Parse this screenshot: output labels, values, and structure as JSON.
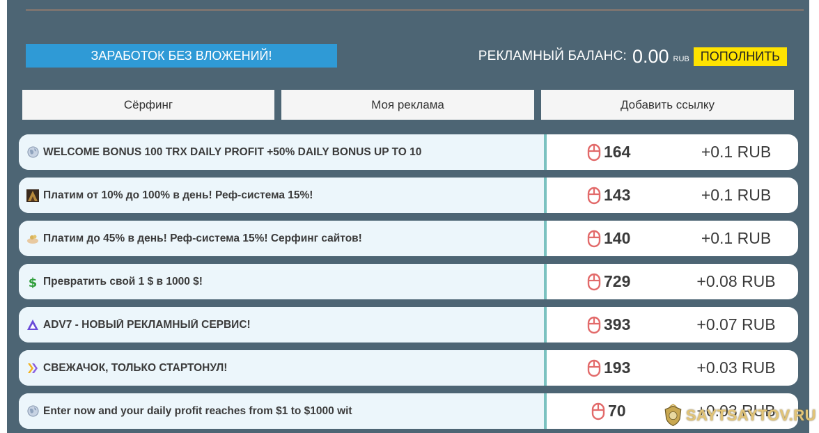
{
  "header": {
    "earn_button_label": "ЗАРАБОТОК БЕЗ ВЛОЖЕНИЙ!",
    "balance_label": "РЕКЛАМНЫЙ БАЛАНС:",
    "balance_value": "0.00",
    "balance_unit": "RUB",
    "topup_label": "ПОПОЛНИТЬ"
  },
  "tabs": [
    {
      "label": "Сёрфинг"
    },
    {
      "label": "Моя реклама"
    },
    {
      "label": "Добавить ссылку"
    }
  ],
  "rows": [
    {
      "icon": "globe-icon",
      "title": "WELCOME BONUS 100 TRX DAILY PROFIT +50% DAILY BONUS UP TO 10",
      "views": "164",
      "price": "+0.1 RUB"
    },
    {
      "icon": "pyramid-image-icon",
      "title": "Платим от 10% до 100% в день! Реф-система 15%!",
      "views": "143",
      "price": "+0.1 RUB"
    },
    {
      "icon": "hand-coins-icon",
      "title": "Платим до 45% в день! Реф-система 15%! Серфинг сайтов!",
      "views": "140",
      "price": "+0.1 RUB"
    },
    {
      "icon": "dollar-icon",
      "title": "Превратить свой 1 $ в 1000 $!",
      "views": "729",
      "price": "+0.08 RUB"
    },
    {
      "icon": "triangle-logo-icon",
      "title": "ADV7 - НОВЫЙ РЕКЛАМНЫЙ СЕРВИС!",
      "views": "393",
      "price": "+0.07 RUB"
    },
    {
      "icon": "chevron-logo-icon",
      "title": "СВЕЖАЧОК, ТОЛЬКО СТАРТОНУЛ!",
      "views": "193",
      "price": "+0.03 RUB"
    },
    {
      "icon": "globe-icon",
      "title": "Enter now and your daily profit reaches from $1 to $1000 wit",
      "views": "70",
      "price": "+0.03 RUB"
    }
  ],
  "watermark": {
    "text": "SAYTSAYTOV.RU"
  },
  "colors": {
    "panel_bg": "#4d6574",
    "earn_button": "#2f9ad6",
    "topup_button": "#ffe300",
    "row_left_bg": "#ecf6fb",
    "separator": "#7bc2c0",
    "mouse_icon": "#e26a6a"
  }
}
